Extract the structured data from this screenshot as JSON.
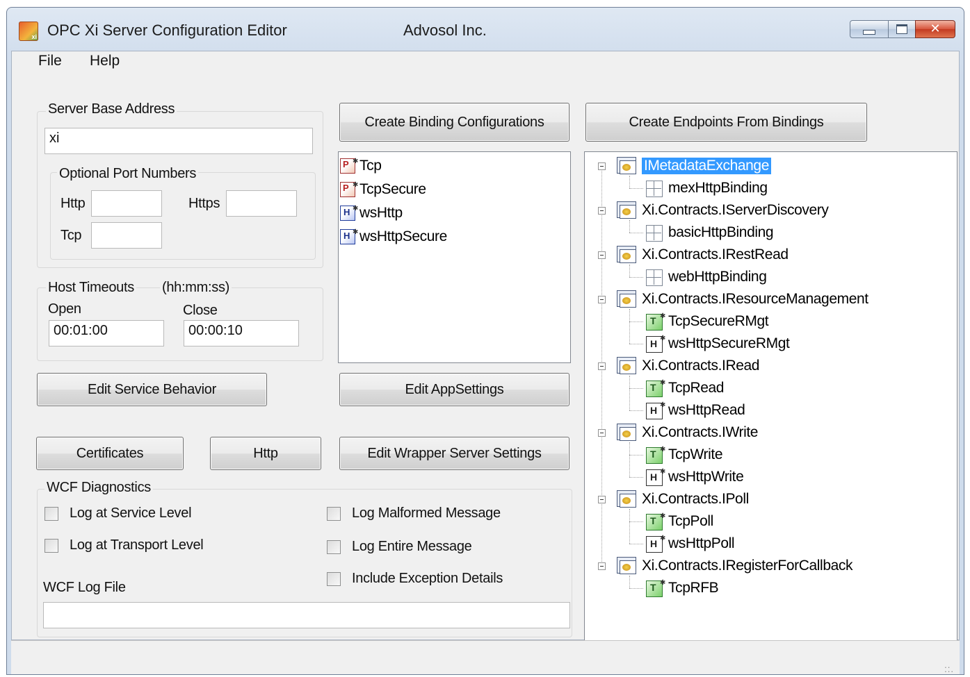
{
  "window": {
    "title": "OPC Xi Server Configuration Editor",
    "company": "Advosol Inc.",
    "app_icon_text": "xi"
  },
  "menu": [
    "File",
    "Help"
  ],
  "server_base_address": {
    "label": "Server Base Address",
    "value": "xi"
  },
  "ports": {
    "label": "Optional Port Numbers",
    "http_label": "Http",
    "http_value": "",
    "https_label": "Https",
    "https_value": "",
    "tcp_label": "Tcp",
    "tcp_value": ""
  },
  "timeouts": {
    "label": "Host Timeouts",
    "format": "(hh:mm:ss)",
    "open_label": "Open",
    "open_value": "00:01:00",
    "close_label": "Close",
    "close_value": "00:00:10"
  },
  "buttons": {
    "create_binding": "Create Binding Configurations",
    "create_endpoints": "Create Endpoints From Bindings",
    "edit_service_behavior": "Edit Service Behavior",
    "edit_appsettings": "Edit AppSettings",
    "certificates": "Certificates",
    "http": "Http",
    "edit_wrapper": "Edit Wrapper Server Settings"
  },
  "bindings_list": [
    {
      "label": "Tcp",
      "icon": "tcp-binding-icon"
    },
    {
      "label": "TcpSecure",
      "icon": "tcp-binding-icon"
    },
    {
      "label": "wsHttp",
      "icon": "http-binding-icon"
    },
    {
      "label": "wsHttpSecure",
      "icon": "http-binding-icon"
    }
  ],
  "endpoints_tree": [
    {
      "label": "IMetadataExchange",
      "selected": true,
      "children": [
        {
          "label": "mexHttpBinding",
          "kind": "plain"
        }
      ]
    },
    {
      "label": "Xi.Contracts.IServerDiscovery",
      "children": [
        {
          "label": "basicHttpBinding",
          "kind": "plain"
        }
      ]
    },
    {
      "label": "Xi.Contracts.IRestRead",
      "children": [
        {
          "label": "webHttpBinding",
          "kind": "plain"
        }
      ]
    },
    {
      "label": "Xi.Contracts.IResourceManagement",
      "children": [
        {
          "label": "TcpSecureRMgt",
          "kind": "tcp"
        },
        {
          "label": "wsHttpSecureRMgt",
          "kind": "http"
        }
      ]
    },
    {
      "label": "Xi.Contracts.IRead",
      "children": [
        {
          "label": "TcpRead",
          "kind": "tcp"
        },
        {
          "label": "wsHttpRead",
          "kind": "http"
        }
      ]
    },
    {
      "label": "Xi.Contracts.IWrite",
      "children": [
        {
          "label": "TcpWrite",
          "kind": "tcp"
        },
        {
          "label": "wsHttpWrite",
          "kind": "http"
        }
      ]
    },
    {
      "label": "Xi.Contracts.IPoll",
      "children": [
        {
          "label": "TcpPoll",
          "kind": "tcp"
        },
        {
          "label": "wsHttpPoll",
          "kind": "http"
        }
      ]
    },
    {
      "label": "Xi.Contracts.IRegisterForCallback",
      "children": [
        {
          "label": "TcpRFB",
          "kind": "tcp"
        }
      ]
    }
  ],
  "diagnostics": {
    "label": "WCF Diagnostics",
    "log_service": "Log at Service Level",
    "log_transport": "Log at Transport Level",
    "log_malformed": "Log Malformed Message",
    "log_entire": "Log Entire Message",
    "include_exception": "Include Exception Details",
    "log_file_label": "WCF Log File",
    "log_file_value": "",
    "checked": {
      "log_service": false,
      "log_transport": false,
      "log_malformed": false,
      "log_entire": false,
      "include_exception": false
    }
  }
}
